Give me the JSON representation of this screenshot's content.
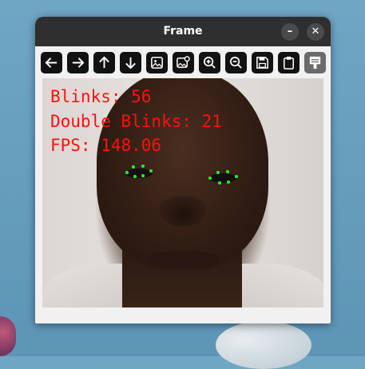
{
  "window": {
    "title": "Frame",
    "minimize_glyph": "–",
    "close_glyph": "✕"
  },
  "toolbar": {
    "buttons": [
      {
        "icon": "arrow-left-icon"
      },
      {
        "icon": "arrow-right-icon"
      },
      {
        "icon": "arrow-up-icon"
      },
      {
        "icon": "arrow-down-icon"
      },
      {
        "icon": "image-icon"
      },
      {
        "icon": "image-settings-icon"
      },
      {
        "icon": "zoom-in-icon"
      },
      {
        "icon": "zoom-out-icon"
      },
      {
        "icon": "save-icon"
      },
      {
        "icon": "clipboard-icon"
      },
      {
        "icon": "properties-icon"
      }
    ]
  },
  "overlay": {
    "blinks": "Blinks: 56",
    "double_blinks": "Double Blinks: 21",
    "fps": "FPS: 148.06",
    "text_color": "#ff1010",
    "landmark_color": "#22ff22"
  }
}
